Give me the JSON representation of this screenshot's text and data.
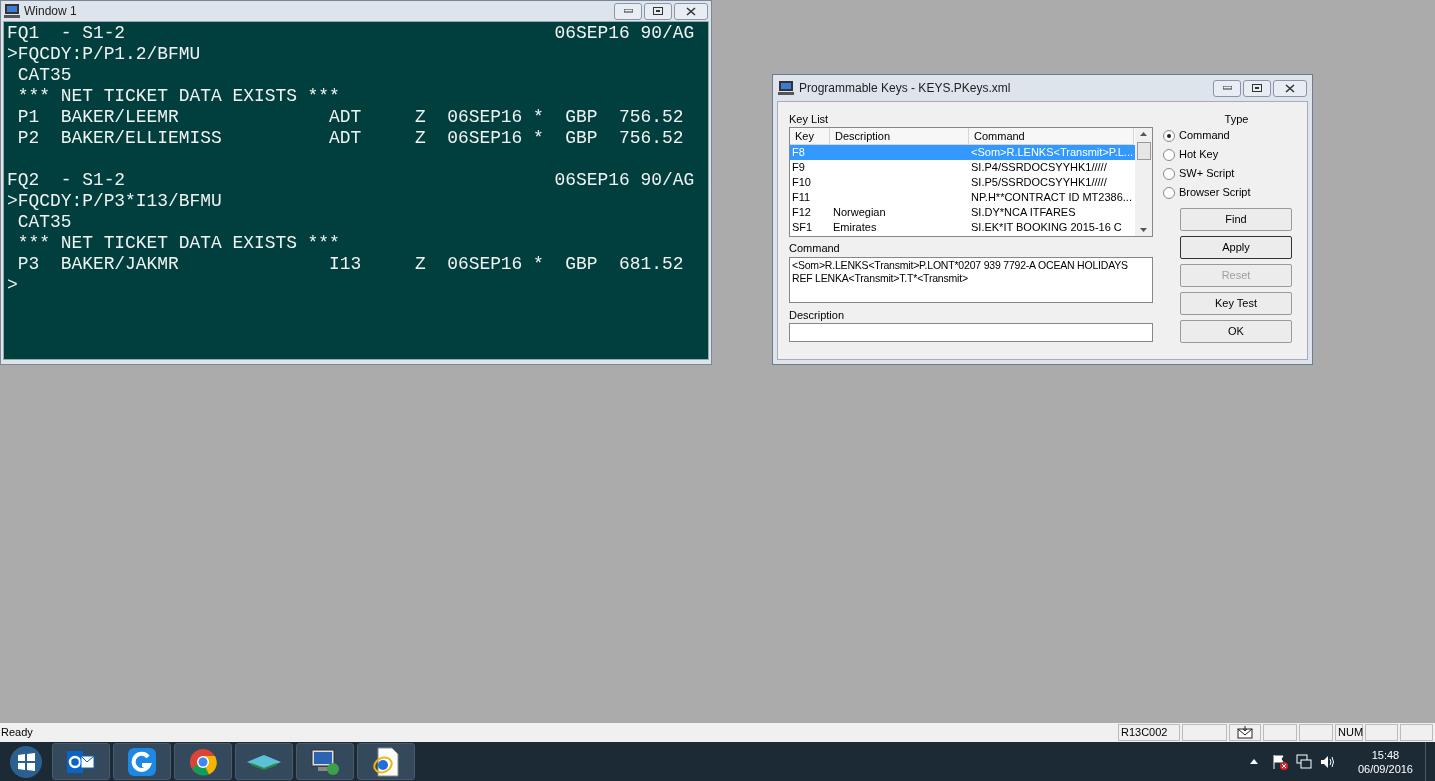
{
  "terminal_window": {
    "title": "Window 1",
    "blocks": [
      {
        "lines": [
          "FQ1  - S1-2                                        06SEP16 90/AG",
          ">FQCDY:P/P1.2/BFMU",
          " CAT35",
          " *** NET TICKET DATA EXISTS ***",
          " P1  BAKER/LEEMR              ADT     Z  06SEP16 *  GBP  756.52",
          " P2  BAKER/ELLIEMISS          ADT     Z  06SEP16 *  GBP  756.52"
        ]
      },
      {
        "lines": [
          "FQ2  - S1-2                                        06SEP16 90/AG",
          ">FQCDY:P/P3*I13/BFMU",
          " CAT35",
          " *** NET TICKET DATA EXISTS ***",
          " P3  BAKER/JAKMR              I13     Z  06SEP16 *  GBP  681.52",
          ">"
        ]
      }
    ]
  },
  "keys_dialog": {
    "title": "Programmable Keys - KEYS.PKeys.xml",
    "key_list_label": "Key List",
    "columns": [
      "Key",
      "Description",
      "Command"
    ],
    "rows": [
      {
        "key": "F8",
        "description": "",
        "command": "<Som>R.LENKS<Transmit>P.L...",
        "selected": true
      },
      {
        "key": "F9",
        "description": "",
        "command": "SI.P4/SSRDOCSYYHK1/////",
        "selected": false
      },
      {
        "key": "F10",
        "description": "",
        "command": "SI.P5/SSRDOCSYYHK1/////",
        "selected": false
      },
      {
        "key": "F11",
        "description": "",
        "command": "NP.H**CONTRACT ID MT2386...",
        "selected": false
      },
      {
        "key": "F12",
        "description": "Norwegian",
        "command": "SI.DY*NCA ITFARES",
        "selected": false
      },
      {
        "key": "SF1",
        "description": "Emirates",
        "command": "SI.EK*IT BOOKING 2015-16 C",
        "selected": false
      }
    ],
    "command_label": "Command",
    "command_value": "<Som>R.LENKS<Transmit>P.LONT*0207 939 7792-A OCEAN HOLIDAYS REF LENKA<Transmit>T.T*<Transmit>",
    "description_label": "Description",
    "type_label": "Type",
    "types": [
      {
        "label": "Command",
        "selected": true
      },
      {
        "label": "Hot Key",
        "selected": false
      },
      {
        "label": "SW+ Script",
        "selected": false
      },
      {
        "label": "Browser Script",
        "selected": false
      }
    ],
    "buttons": [
      {
        "label": "Find",
        "disabled": false
      },
      {
        "label": "Apply",
        "disabled": false
      },
      {
        "label": "Reset",
        "disabled": true
      },
      {
        "label": "Key Test",
        "disabled": false
      },
      {
        "label": "OK",
        "disabled": false
      }
    ]
  },
  "status_bar": {
    "text": "Ready",
    "panels": [
      {
        "kind": "text",
        "text": "R13C002"
      },
      {
        "kind": "empty"
      },
      {
        "kind": "mail"
      },
      {
        "kind": "empty"
      },
      {
        "kind": "empty"
      },
      {
        "kind": "text",
        "text": "NUM"
      },
      {
        "kind": "empty"
      },
      {
        "kind": "empty"
      }
    ]
  },
  "taskbar": {
    "apps": [
      {
        "kind": "mail",
        "selected": false
      },
      {
        "kind": "g",
        "selected": false
      },
      {
        "kind": "browser",
        "selected": false
      },
      {
        "kind": "layers",
        "selected": false
      },
      {
        "kind": "remote",
        "selected": false
      },
      {
        "kind": "ie",
        "selected": false
      }
    ],
    "time": "15:48",
    "date": "06/09/2016"
  }
}
